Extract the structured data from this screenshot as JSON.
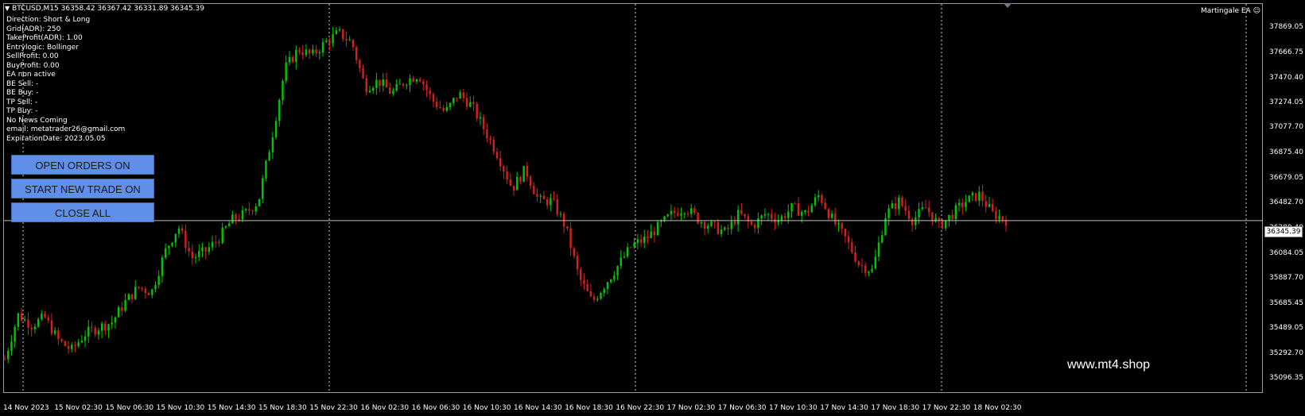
{
  "symbol_line": "BTCUSD,M15  36358.42 36367.42 36331.89 36345.39",
  "ea_name": "Martingale EA",
  "info_lines": [
    "Direction: Short & Long",
    "Grid(ADR): 250",
    "TakeProfit(ADR): 1.00",
    "Entrylogic: Bollinger",
    "SellProfit: 0.00",
    "BuyProfit: 0.00",
    "EA non active",
    "BE Sell: -",
    "BE Buy: -",
    "TP Sell: -",
    "TP Buy: -",
    "No News Coming",
    "email: metatrader26@gmail.com",
    "ExpirationDate: 2023.05.05"
  ],
  "buttons": {
    "open_orders": "OPEN ORDERS ON",
    "start_new_trade": "START NEW TRADE ON",
    "close_all": "CLOSE ALL"
  },
  "current_price": "36345.39",
  "watermark": "www.mt4.shop",
  "colors": {
    "up": "#00c800",
    "down": "#d81e1e",
    "background": "#000000",
    "button": "#5f8fe8"
  },
  "icons": [
    "dropdown-triangle-icon",
    "smiley-icon"
  ],
  "chart_data": {
    "type": "candlestick",
    "symbol": "BTCUSD",
    "timeframe": "M15",
    "y_ticks": [
      "37869.05",
      "37666.75",
      "37470.40",
      "37274.05",
      "37077.70",
      "36875.40",
      "36679.05",
      "36482.70",
      "36280.40",
      "36084.05",
      "35887.70",
      "35685.45",
      "35489.05",
      "35292.70",
      "35096.35"
    ],
    "x_ticks": [
      "14 Nov 2023",
      "15 Nov 02:30",
      "15 Nov 06:30",
      "15 Nov 10:30",
      "15 Nov 14:30",
      "15 Nov 18:30",
      "15 Nov 22:30",
      "16 Nov 02:30",
      "16 Nov 06:30",
      "16 Nov 10:30",
      "16 Nov 14:30",
      "16 Nov 18:30",
      "16 Nov 22:30",
      "17 Nov 02:30",
      "17 Nov 06:30",
      "17 Nov 10:30",
      "17 Nov 14:30",
      "17 Nov 18:30",
      "17 Nov 22:30",
      "18 Nov 02:30"
    ],
    "ylim": [
      35096.35,
      37869.05
    ],
    "close_path": [
      [
        0,
        35250
      ],
      [
        2,
        35600
      ],
      [
        4,
        35520
      ],
      [
        6,
        35580
      ],
      [
        8,
        35400
      ],
      [
        10,
        35320
      ],
      [
        12,
        35450
      ],
      [
        14,
        35500
      ],
      [
        16,
        35540
      ],
      [
        18,
        35700
      ],
      [
        20,
        35820
      ],
      [
        22,
        35780
      ],
      [
        24,
        36100
      ],
      [
        26,
        36300
      ],
      [
        28,
        36050
      ],
      [
        30,
        36100
      ],
      [
        32,
        36200
      ],
      [
        34,
        36350
      ],
      [
        36,
        36400
      ],
      [
        38,
        36500
      ],
      [
        40,
        37000
      ],
      [
        42,
        37550
      ],
      [
        44,
        37700
      ],
      [
        46,
        37650
      ],
      [
        48,
        37750
      ],
      [
        50,
        37830
      ],
      [
        52,
        37750
      ],
      [
        54,
        37400
      ],
      [
        56,
        37450
      ],
      [
        58,
        37350
      ],
      [
        60,
        37450
      ],
      [
        62,
        37500
      ],
      [
        64,
        37300
      ],
      [
        66,
        37200
      ],
      [
        68,
        37350
      ],
      [
        70,
        37250
      ],
      [
        72,
        37050
      ],
      [
        74,
        36850
      ],
      [
        76,
        36600
      ],
      [
        78,
        36750
      ],
      [
        80,
        36500
      ],
      [
        82,
        36500
      ],
      [
        84,
        36300
      ],
      [
        86,
        35900
      ],
      [
        88,
        35700
      ],
      [
        90,
        35850
      ],
      [
        92,
        36000
      ],
      [
        94,
        36150
      ],
      [
        96,
        36200
      ],
      [
        98,
        36300
      ],
      [
        100,
        36400
      ],
      [
        102,
        36450
      ],
      [
        104,
        36350
      ],
      [
        106,
        36300
      ],
      [
        108,
        36250
      ],
      [
        110,
        36400
      ],
      [
        112,
        36300
      ],
      [
        114,
        36400
      ],
      [
        116,
        36350
      ],
      [
        118,
        36450
      ],
      [
        120,
        36400
      ],
      [
        122,
        36550
      ],
      [
        124,
        36350
      ],
      [
        126,
        36200
      ],
      [
        128,
        36000
      ],
      [
        130,
        35950
      ],
      [
        132,
        36400
      ],
      [
        134,
        36500
      ],
      [
        136,
        36350
      ],
      [
        138,
        36450
      ],
      [
        140,
        36300
      ],
      [
        142,
        36400
      ],
      [
        144,
        36500
      ],
      [
        146,
        36550
      ],
      [
        148,
        36400
      ],
      [
        150,
        36350
      ]
    ]
  }
}
